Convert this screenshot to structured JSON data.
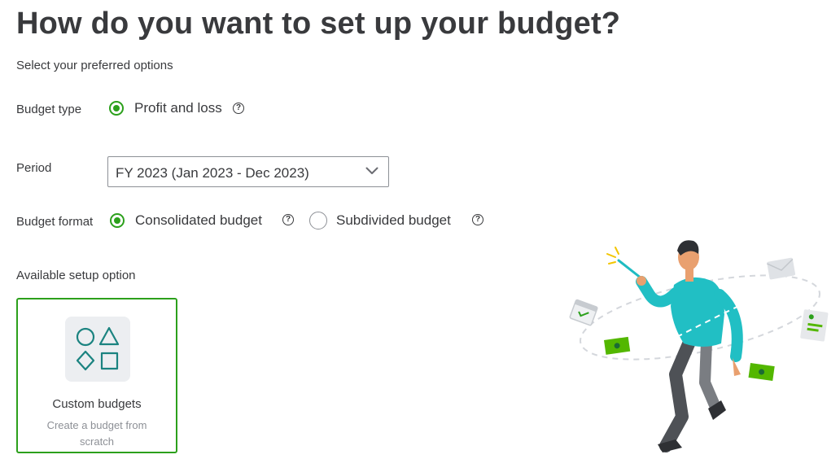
{
  "page": {
    "title": "How do you want to set up your budget?",
    "subtitle": "Select your preferred options"
  },
  "budget_type": {
    "label": "Budget type",
    "options": [
      {
        "label": "Profit and loss",
        "selected": true
      }
    ]
  },
  "period": {
    "label": "Period",
    "selected": "FY 2023 (Jan 2023 - Dec 2023)"
  },
  "budget_format": {
    "label": "Budget format",
    "options": [
      {
        "label": "Consolidated budget",
        "selected": true
      },
      {
        "label": "Subdivided budget",
        "selected": false
      }
    ]
  },
  "setup": {
    "label": "Available setup option",
    "cards": [
      {
        "title": "Custom budgets",
        "description": "Create a budget from scratch",
        "selected": true,
        "icon": "shapes-icon"
      }
    ]
  },
  "help_glyph": "?",
  "colors": {
    "accent": "#2ca01c",
    "icon_teal": "#1b8380",
    "text": "#393a3d",
    "muted": "#8d9096"
  }
}
